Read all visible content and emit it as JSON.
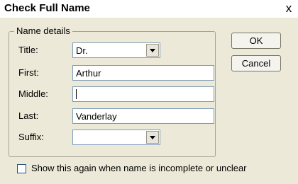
{
  "window": {
    "title": "Check Full Name",
    "close_glyph": "x"
  },
  "group": {
    "label": "Name details"
  },
  "fields": {
    "title": {
      "label": "Title:",
      "value": "Dr."
    },
    "first": {
      "label": "First:",
      "value": "Arthur"
    },
    "middle": {
      "label": "Middle:",
      "value": ""
    },
    "last": {
      "label": "Last:",
      "value": "Vanderlay"
    },
    "suffix": {
      "label": "Suffix:",
      "value": ""
    }
  },
  "buttons": {
    "ok": "OK",
    "cancel": "Cancel"
  },
  "option": {
    "label": "Show this again when name is incomplete or unclear",
    "checked": false
  },
  "icons": {
    "close": "close-icon",
    "dropdown": "chevron-down-icon"
  },
  "colors": {
    "dialog_bg": "#ece9d8",
    "field_border": "#7f9db9",
    "group_border": "#a6a392"
  }
}
